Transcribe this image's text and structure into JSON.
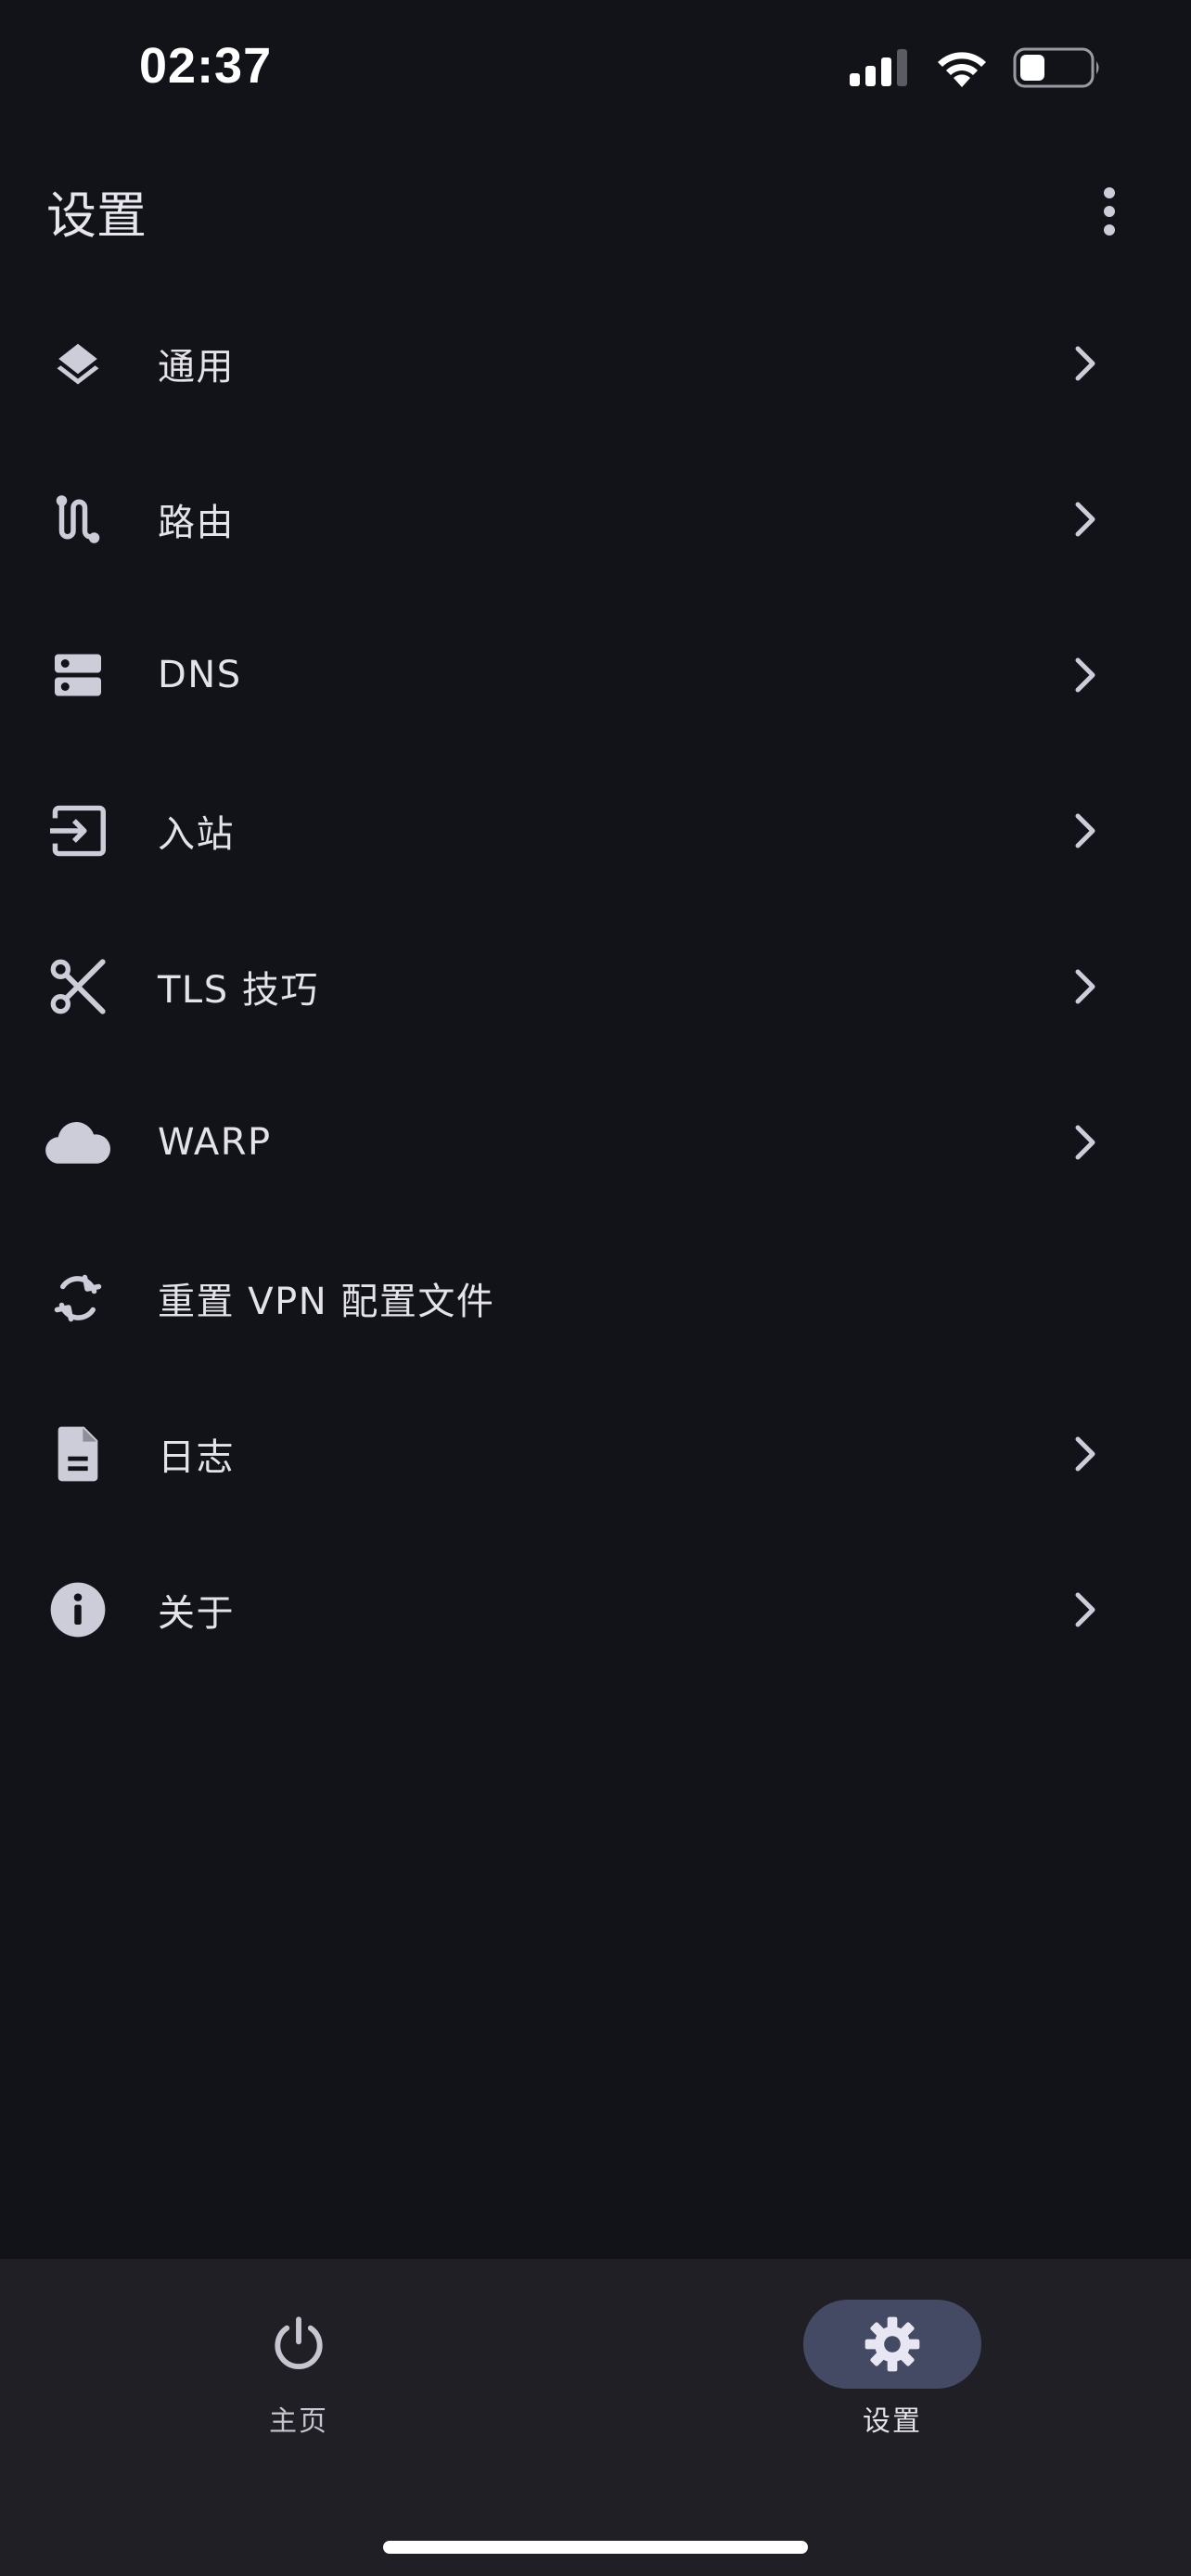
{
  "status_bar": {
    "time": "02:37",
    "icons": [
      "cellular-signal-icon",
      "wifi-icon",
      "battery-icon"
    ]
  },
  "app_bar": {
    "title": "设置",
    "menu_icon": "more-vert-icon"
  },
  "settings": {
    "items": [
      {
        "label": "通用",
        "icon": "layers-icon",
        "has_chevron": true
      },
      {
        "label": "路由",
        "icon": "route-icon",
        "has_chevron": true
      },
      {
        "label": "DNS",
        "icon": "dns-icon",
        "has_chevron": true
      },
      {
        "label": "入站",
        "icon": "input-icon",
        "has_chevron": true
      },
      {
        "label": "TLS 技巧",
        "icon": "scissors-icon",
        "has_chevron": true
      },
      {
        "label": "WARP",
        "icon": "cloud-icon",
        "has_chevron": true
      },
      {
        "label": "重置 VPN 配置文件",
        "icon": "sync-icon",
        "has_chevron": false
      },
      {
        "label": "日志",
        "icon": "document-icon",
        "has_chevron": true
      },
      {
        "label": "关于",
        "icon": "info-icon",
        "has_chevron": true
      }
    ]
  },
  "bottom_nav": {
    "items": [
      {
        "label": "主页",
        "icon": "power-icon",
        "selected": false
      },
      {
        "label": "设置",
        "icon": "settings-gear-icon",
        "selected": true
      }
    ]
  },
  "colors": {
    "background": "#121318",
    "nav_background": "#1f1f25",
    "text": "#e4e3ea",
    "icon": "#cdcdd9",
    "selected_pill": "#444a63"
  }
}
